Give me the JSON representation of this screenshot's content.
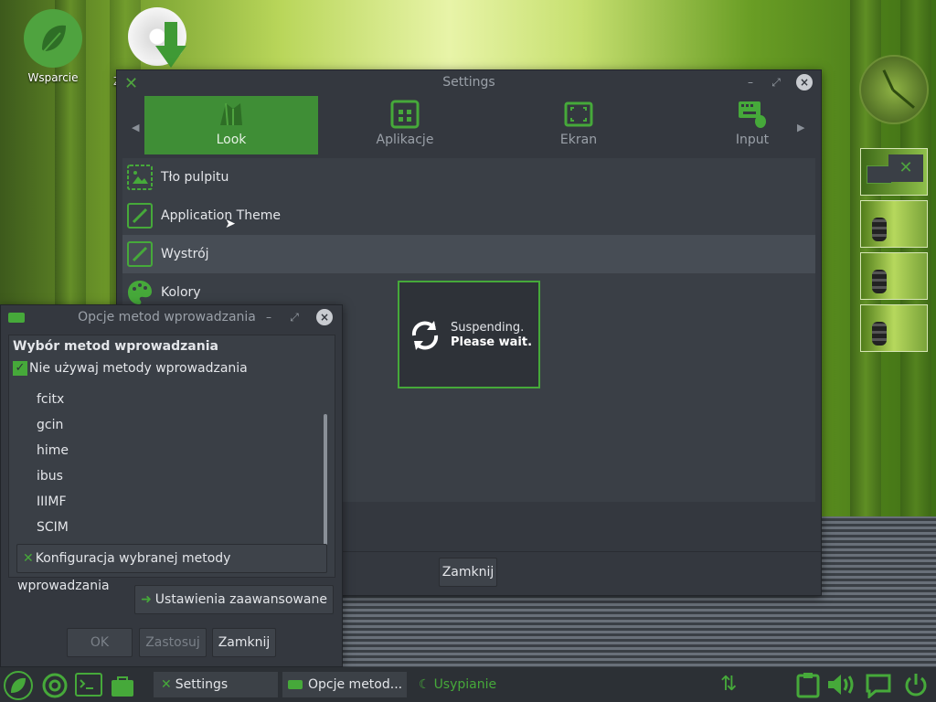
{
  "desktop": {
    "icons": [
      {
        "label": "Wsparcie"
      },
      {
        "label": "Z"
      }
    ]
  },
  "settings_window": {
    "title": "Settings",
    "tabs": [
      {
        "label": "Look",
        "active": true
      },
      {
        "label": "Aplikacje",
        "active": false
      },
      {
        "label": "Ekran",
        "active": false
      },
      {
        "label": "Input",
        "active": false
      }
    ],
    "items": [
      {
        "label": "Tło pulpitu"
      },
      {
        "label": "Application Theme"
      },
      {
        "label": "Wystrój"
      },
      {
        "label": "Kolory"
      }
    ],
    "close_button": "Zamknij"
  },
  "suspend_popup": {
    "line1": "Suspending.",
    "line2": "Please wait."
  },
  "input_method_window": {
    "title": "Opcje metod wprowadzania",
    "section_title": "Wybór metod wprowadzania",
    "checkbox_label": "Nie używaj metody wprowadzania",
    "methods": [
      "fcitx",
      "gcin",
      "hime",
      "ibus",
      "IIIMF",
      "SCIM"
    ],
    "config_button": "Konfiguracja wybranej metody wprowadzania",
    "advanced_button": "Ustawienia zaawansowane",
    "ok_button": "OK",
    "apply_button": "Zastosuj",
    "close_button": "Zamknij"
  },
  "taskbar": {
    "tasks": [
      {
        "label": "Settings"
      },
      {
        "label": "Opcje metod..."
      }
    ],
    "status_text": "Usypianie"
  },
  "colors": {
    "accent": "#3f8e36",
    "window_bg": "#34383f",
    "popup_border": "#46a93a"
  }
}
